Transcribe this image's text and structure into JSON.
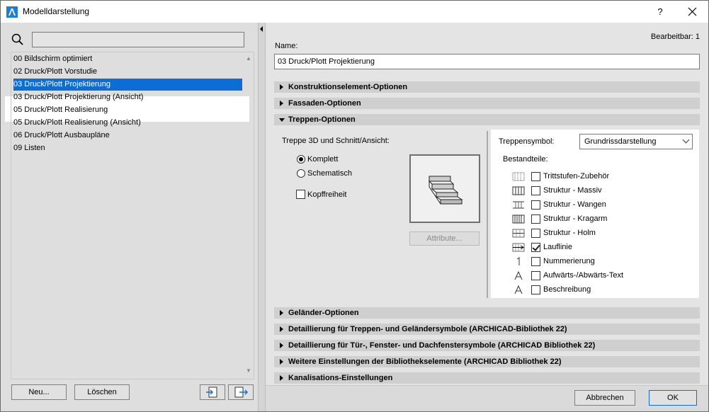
{
  "window": {
    "title": "Modelldarstellung",
    "help_label": "?"
  },
  "left": {
    "search_value": "",
    "items": [
      {
        "label": "00 Bildschirm optimiert",
        "selected": false
      },
      {
        "label": "02 Druck/Plott Vorstudie",
        "selected": false
      },
      {
        "label": "03 Druck/Plott Projektierung",
        "selected": true
      },
      {
        "label": "03 Druck/Plott Projektierung (Ansicht)",
        "selected": false
      },
      {
        "label": "05 Druck/Plott Realisierung",
        "selected": false
      },
      {
        "label": "05 Druck/Plott Realisierung (Ansicht)",
        "selected": false
      },
      {
        "label": "06 Druck/Plott Ausbaupläne",
        "selected": false
      },
      {
        "label": "09 Listen",
        "selected": false
      }
    ],
    "new_label": "Neu...",
    "delete_label": "Löschen"
  },
  "right": {
    "editable": "Bearbeitbar: 1",
    "name_label": "Name:",
    "name_value": "03 Druck/Plott Projektierung",
    "sections_top": [
      {
        "label": "Konstruktionselement-Optionen",
        "expanded": false
      },
      {
        "label": "Fassaden-Optionen",
        "expanded": false
      },
      {
        "label": "Treppen-Optionen",
        "expanded": true
      }
    ],
    "stair": {
      "group_label": "Treppe 3D und Schnitt/Ansicht:",
      "opt_complete": "Komplett",
      "opt_schematic": "Schematisch",
      "selected_option": "Komplett",
      "headroom_label": "Kopffreiheit",
      "headroom_checked": false,
      "attributes_label": "Attribute...",
      "symbol_label": "Treppensymbol:",
      "symbol_value": "Grundrissdarstellung",
      "components_label": "Bestandteile:",
      "components": [
        {
          "label": "Trittstufen-Zubehör",
          "checked": false,
          "icon": "tread-accessories-icon"
        },
        {
          "label": "Struktur - Massiv",
          "checked": false,
          "icon": "structure-solid-icon"
        },
        {
          "label": "Struktur - Wangen",
          "checked": false,
          "icon": "structure-stringers-icon"
        },
        {
          "label": "Struktur - Kragarm",
          "checked": false,
          "icon": "structure-cantilever-icon"
        },
        {
          "label": "Struktur - Holm",
          "checked": false,
          "icon": "structure-beam-icon"
        },
        {
          "label": "Lauflinie",
          "checked": true,
          "icon": "walking-line-icon"
        },
        {
          "label": "Nummerierung",
          "checked": false,
          "icon": "numbering-icon"
        },
        {
          "label": "Aufwärts-/Abwärts-Text",
          "checked": false,
          "icon": "up-down-text-icon"
        },
        {
          "label": "Beschreibung",
          "checked": false,
          "icon": "description-icon"
        }
      ]
    },
    "sections_bottom": [
      {
        "label": "Geländer-Optionen"
      },
      {
        "label": "Detaillierung für Treppen- und Geländersymbole (ARCHICAD-Bibliothek 22)"
      },
      {
        "label": "Detaillierung für Tür-, Fenster- und Dachfenstersymbole (ARCHICAD Bibliothek 22)"
      },
      {
        "label": "Weitere Einstellungen der Bibliothekselemente (ARCHICAD Bibliothek 22)"
      },
      {
        "label": "Kanalisations-Einstellungen"
      }
    ],
    "cancel_label": "Abbrechen",
    "ok_label": "OK"
  }
}
